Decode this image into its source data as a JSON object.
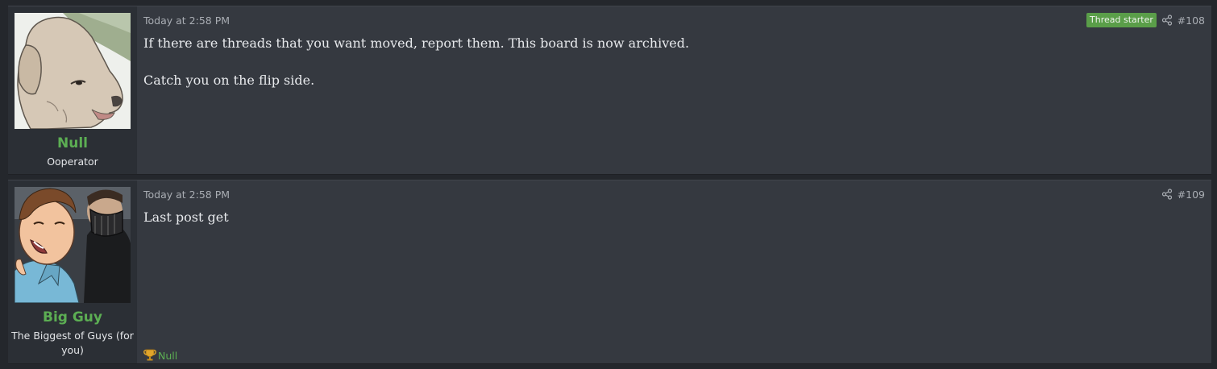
{
  "posts": [
    {
      "author": {
        "name": "Null",
        "title": "Ooperator",
        "avatar": "dog-avatar"
      },
      "time": "Today at 2:58 PM",
      "badge": "Thread starter",
      "number": "#108",
      "body": [
        "If there are threads that you want moved, report them. This board is now archived.",
        "Catch you on the flip side."
      ]
    },
    {
      "author": {
        "name": "Big Guy",
        "title": "The Biggest of Guys (for you)",
        "avatar": "masked-man-avatar"
      },
      "time": "Today at 2:58 PM",
      "number": "#109",
      "body": [
        "Last post get"
      ],
      "reaction": {
        "icon": "trophy-icon",
        "user": "Null"
      }
    }
  ],
  "colors": {
    "page_bg": "#24272c",
    "post_bg": "#353940",
    "user_cell_bg": "#2b2f35",
    "username": "#5cae53",
    "badge_bg": "#5a9e49",
    "meta_text": "#a9adb3",
    "body_text": "#e7e9ec"
  }
}
